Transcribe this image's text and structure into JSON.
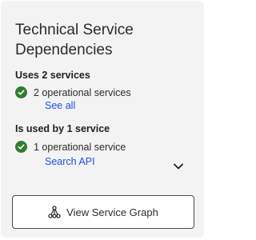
{
  "card": {
    "title": "Technical Service Dependencies"
  },
  "uses": {
    "heading": "Uses 2 services",
    "status_text": "2 operational services",
    "link_label": "See all"
  },
  "used_by": {
    "heading": "Is used by 1 service",
    "status_text": "1 operational service",
    "link_label": "Search API"
  },
  "graph_button": {
    "label": "View Service Graph"
  },
  "colors": {
    "panel_bg": "#f3f3f3",
    "status_ok": "#2e7d32",
    "link": "#1d4fd8"
  }
}
